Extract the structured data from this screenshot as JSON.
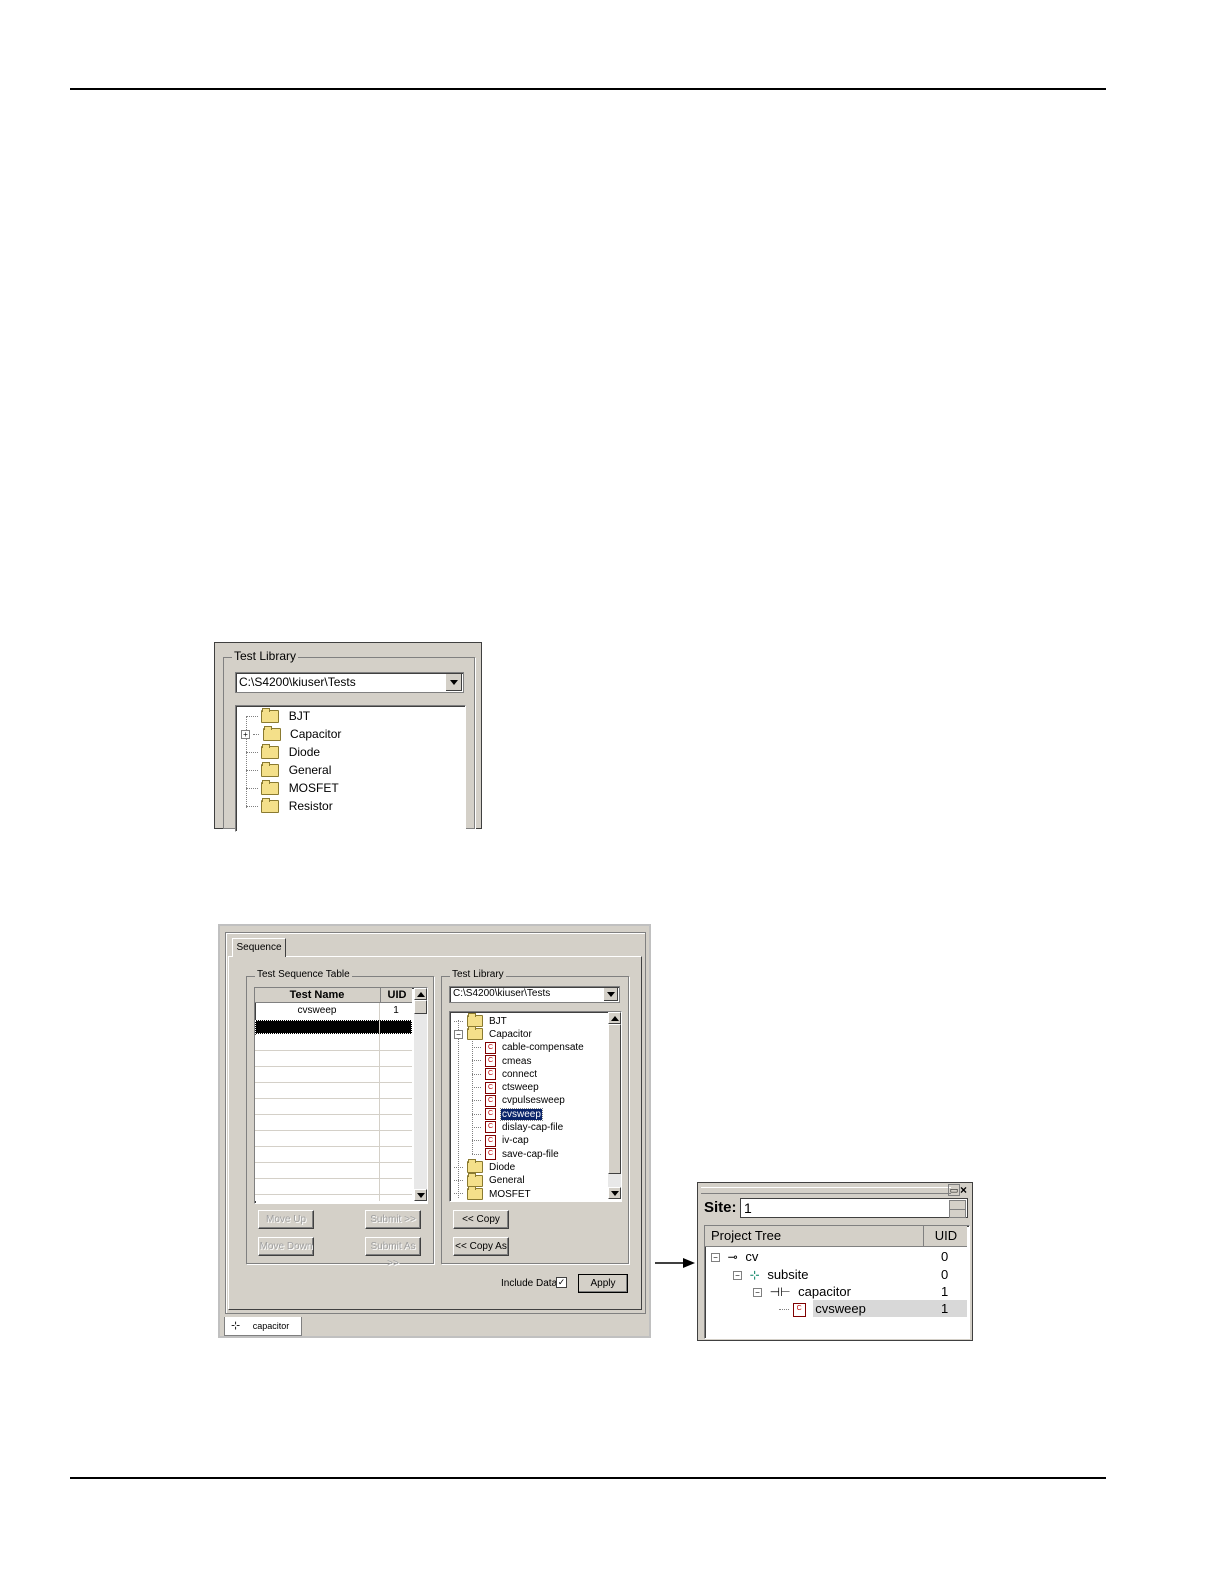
{
  "fig1": {
    "group_label": "Test Library",
    "path": "C:\\S4200\\kiuser\\Tests",
    "items": [
      {
        "label": "BJT",
        "expander": ""
      },
      {
        "label": "Capacitor",
        "expander": "+"
      },
      {
        "label": "Diode",
        "expander": ""
      },
      {
        "label": "General",
        "expander": ""
      },
      {
        "label": "MOSFET",
        "expander": ""
      },
      {
        "label": "Resistor",
        "expander": ""
      }
    ]
  },
  "fig2": {
    "tab": "Sequence",
    "seq_group_label": "Test Sequence Table",
    "table_headers": {
      "name": "Test Name",
      "uid": "UID"
    },
    "table_rows": [
      {
        "name": "cvsweep",
        "uid": "1"
      }
    ],
    "buttons": {
      "move_up": "Move Up",
      "move_down": "Move Down",
      "submit": "Submit >>",
      "submit_as": "Submit As >>",
      "copy": "<< Copy",
      "copy_as": "<< Copy As",
      "apply": "Apply"
    },
    "lib_group_label": "Test Library",
    "lib_path": "C:\\S4200\\kiuser\\Tests",
    "lib_items": [
      {
        "label": "BJT",
        "kind": "folder",
        "level": 0
      },
      {
        "label": "Capacitor",
        "kind": "folder",
        "level": 0,
        "expander": "−"
      },
      {
        "label": "cable-compensate",
        "kind": "test",
        "level": 1
      },
      {
        "label": "cmeas",
        "kind": "test",
        "level": 1
      },
      {
        "label": "connect",
        "kind": "test",
        "level": 1
      },
      {
        "label": "ctsweep",
        "kind": "test",
        "level": 1
      },
      {
        "label": "cvpulsesweep",
        "kind": "test",
        "level": 1
      },
      {
        "label": "cvsweep",
        "kind": "test",
        "level": 1,
        "selected": true
      },
      {
        "label": "dislay-cap-file",
        "kind": "test",
        "level": 1
      },
      {
        "label": "iv-cap",
        "kind": "test",
        "level": 1
      },
      {
        "label": "save-cap-file",
        "kind": "test",
        "level": 1
      },
      {
        "label": "Diode",
        "kind": "folder",
        "level": 0
      },
      {
        "label": "General",
        "kind": "folder",
        "level": 0
      },
      {
        "label": "MOSFET",
        "kind": "folder",
        "level": 0
      }
    ],
    "include_data": "Include Data",
    "bottom_tab": "capacitor"
  },
  "fig3": {
    "site_label": "Site:",
    "site_value": "1",
    "headers": {
      "tree": "Project Tree",
      "uid": "UID"
    },
    "rows": [
      {
        "label": "cv",
        "uid": "0"
      },
      {
        "label": "subsite",
        "uid": "0"
      },
      {
        "label": "capacitor",
        "uid": "1"
      },
      {
        "label": "cvsweep",
        "uid": "1"
      }
    ]
  }
}
